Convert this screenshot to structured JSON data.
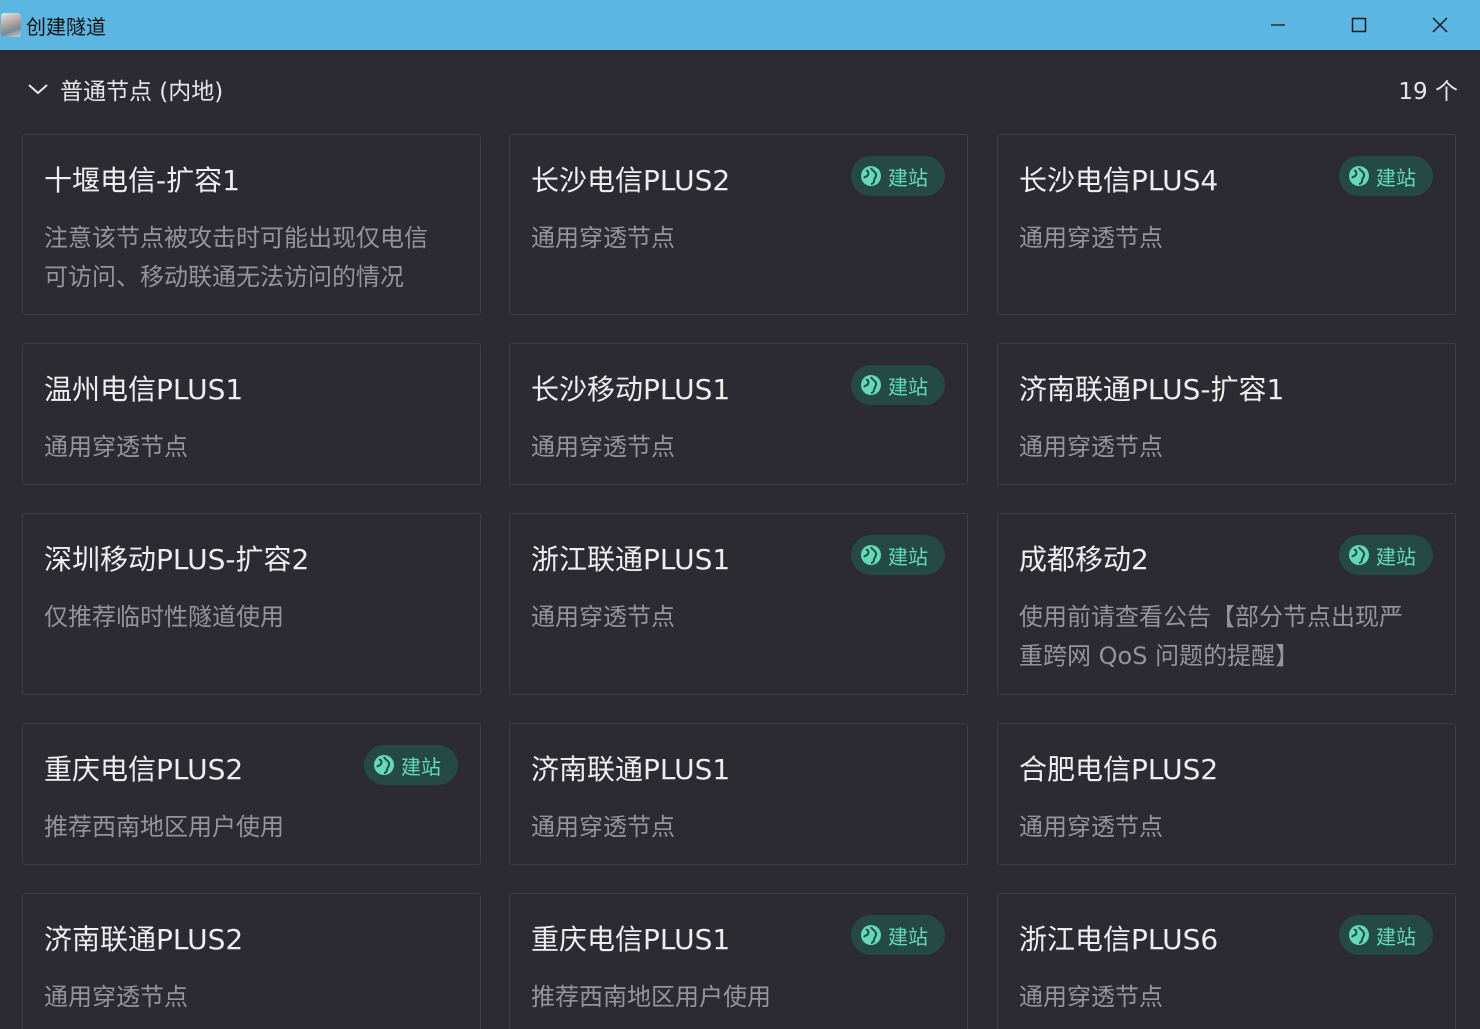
{
  "window": {
    "title": "创建隧道",
    "minimize_icon": "minimize-icon",
    "maximize_icon": "maximize-icon",
    "close_icon": "close-icon"
  },
  "group": {
    "title": "普通节点 (内地)",
    "count": "19 个",
    "expand_icon": "chevron-down-icon"
  },
  "colors": {
    "titlebar": "#5bb6e2",
    "background": "#2c2b31",
    "card_border": "#3d3c43",
    "badge_bg": "#244a43",
    "badge_text": "#64d9b5"
  },
  "nodes": [
    {
      "name": "十堰电信-扩容1",
      "desc": "注意该节点被攻击时可能出现仅电信可访问、移动联通无法访问的情况",
      "badge": ""
    },
    {
      "name": "长沙电信PLUS2",
      "desc": "通用穿透节点",
      "badge": "建站"
    },
    {
      "name": "长沙电信PLUS4",
      "desc": "通用穿透节点",
      "badge": "建站"
    },
    {
      "name": "温州电信PLUS1",
      "desc": "通用穿透节点",
      "badge": ""
    },
    {
      "name": "长沙移动PLUS1",
      "desc": "通用穿透节点",
      "badge": "建站"
    },
    {
      "name": "济南联通PLUS-扩容1",
      "desc": "通用穿透节点",
      "badge": ""
    },
    {
      "name": "深圳移动PLUS-扩容2",
      "desc": "仅推荐临时性隧道使用",
      "badge": ""
    },
    {
      "name": "浙江联通PLUS1",
      "desc": "通用穿透节点",
      "badge": "建站"
    },
    {
      "name": "成都移动2",
      "desc": "使用前请查看公告【部分节点出现严重跨网 QoS 问题的提醒】",
      "badge": "建站"
    },
    {
      "name": "重庆电信PLUS2",
      "desc": "推荐西南地区用户使用",
      "badge": "建站"
    },
    {
      "name": "济南联通PLUS1",
      "desc": "通用穿透节点",
      "badge": ""
    },
    {
      "name": "合肥电信PLUS2",
      "desc": "通用穿透节点",
      "badge": ""
    },
    {
      "name": "济南联通PLUS2",
      "desc": "通用穿透节点",
      "badge": ""
    },
    {
      "name": "重庆电信PLUS1",
      "desc": "推荐西南地区用户使用",
      "badge": "建站"
    },
    {
      "name": "浙江电信PLUS6",
      "desc": "通用穿透节点",
      "badge": "建站"
    }
  ]
}
